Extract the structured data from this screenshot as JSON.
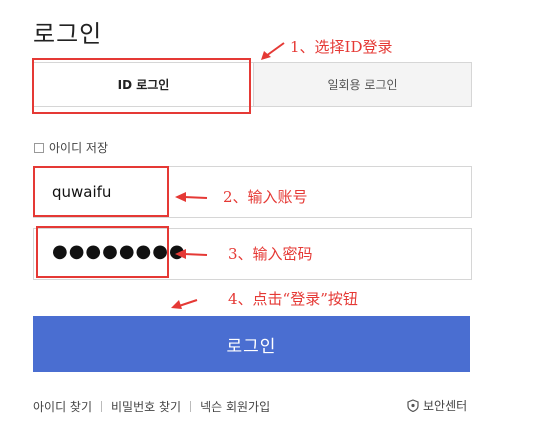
{
  "page": {
    "title": "로그인"
  },
  "tabs": [
    {
      "label": "ID 로그인",
      "active": true
    },
    {
      "label": "일회용 로그인",
      "active": false
    }
  ],
  "save_id": {
    "label": "아이디 저장",
    "checked": false
  },
  "id_field": {
    "value": "quwaifu"
  },
  "password_field": {
    "value": "●●●●●●●●"
  },
  "login_button": {
    "label": "로그인"
  },
  "footer": {
    "links": [
      "아이디 찾기",
      "비밀번호 찾기",
      "넥슨 회원가입"
    ],
    "security_center": "보안센터"
  },
  "annotations": {
    "step1": "1、选择ID登录",
    "step2": "2、输入账号",
    "step3": "3、输入密码",
    "step4": "4、点击“登录”按钮"
  },
  "watermark": "",
  "colors": {
    "accent": "#4a6ed1",
    "annotation": "#e53935",
    "border": "#d6d6d6",
    "inactive_tab": "#f4f4f4"
  },
  "icons": {
    "security": "shield-icon",
    "arrow": "arrow-left-icon"
  }
}
